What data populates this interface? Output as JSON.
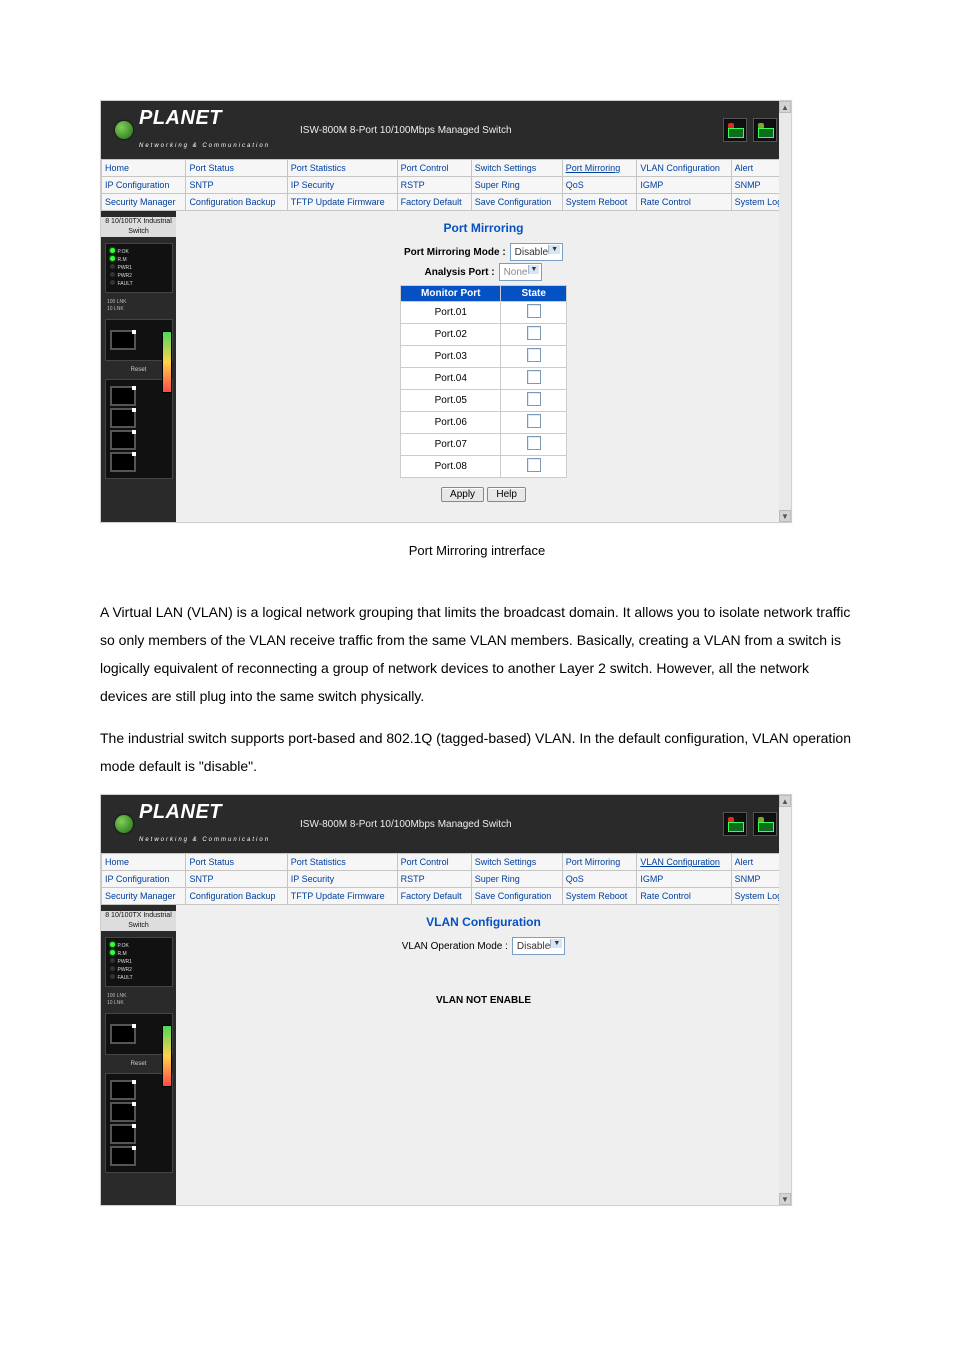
{
  "brand": {
    "name": "PLANET",
    "sub": "Networking & Communication"
  },
  "product_title": "ISW-800M 8-Port 10/100Mbps Managed Switch",
  "nav": {
    "rows": [
      [
        "Home",
        "Port Status",
        "Port Statistics",
        "Port Control",
        "Switch Settings",
        "Port Mirroring",
        "VLAN Configuration",
        "Alert"
      ],
      [
        "IP Configuration",
        "SNTP",
        "IP Security",
        "RSTP",
        "Super Ring",
        "QoS",
        "IGMP",
        "SNMP"
      ],
      [
        "Security Manager",
        "Configuration Backup",
        "TFTP Update Firmware",
        "Factory Default",
        "Save Configuration",
        "System Reboot",
        "Rate Control",
        "System Log"
      ]
    ],
    "active_top": "Port Mirroring",
    "active_bottom": "VLAN Configuration"
  },
  "device_panel": {
    "caption": "8 10/100TX Industrial Switch",
    "leds": [
      "P.OK",
      "R.M",
      "PWR1",
      "PWR2",
      "FAULT"
    ],
    "meter_label": "100 LNK\n10 LNK",
    "reset": "Reset"
  },
  "port_mirroring": {
    "title": "Port Mirroring",
    "mode_label": "Port Mirroring Mode :",
    "mode_value": "Disable",
    "analysis_label": "Analysis Port :",
    "analysis_value": "None",
    "cols": [
      "Monitor Port",
      "State"
    ],
    "ports": [
      "Port.01",
      "Port.02",
      "Port.03",
      "Port.04",
      "Port.05",
      "Port.06",
      "Port.07",
      "Port.08"
    ],
    "buttons": {
      "apply": "Apply",
      "help": "Help"
    }
  },
  "caption1": "Port Mirroring intrerface",
  "vlan_intro": [
    "A Virtual LAN (VLAN) is a logical network grouping that limits the broadcast domain. It allows you to isolate network traffic so only members of the VLAN receive traffic from the same VLAN members. Basically, creating a VLAN from a switch is logically equivalent of reconnecting a group of network devices to another Layer 2 switch. However, all the network devices are still plug into the same switch physically.",
    "The industrial switch supports port-based and 802.1Q (tagged-based) VLAN. In the default configuration, VLAN operation mode default is \"disable\"."
  ],
  "vlan_config": {
    "title": "VLAN Configuration",
    "mode_label": "VLAN Operation Mode :",
    "mode_value": "Disable",
    "not_enabled": "VLAN NOT ENABLE"
  }
}
